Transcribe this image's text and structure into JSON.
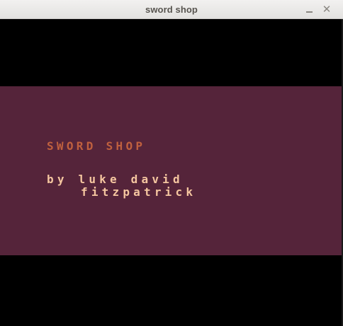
{
  "window": {
    "title": "sword shop",
    "minimize_label": "–",
    "close_label": "✕"
  },
  "game": {
    "title": "SWORD SHOP",
    "byline_1": "by luke david",
    "byline_2": "fitzpatrick",
    "colors": {
      "background": "#000000",
      "band": "#55243a",
      "title": "#c0603e",
      "byline": "#f5c6a0"
    }
  }
}
